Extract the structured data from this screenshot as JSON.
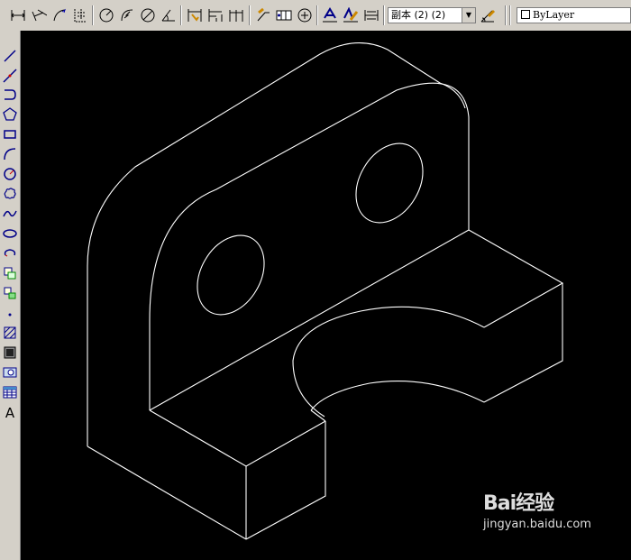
{
  "toolbar": {
    "buttons": [
      {
        "name": "linear-dim-icon"
      },
      {
        "name": "aligned-dim-icon"
      },
      {
        "name": "arc-length-icon"
      },
      {
        "name": "ordinate-dim-icon"
      },
      {
        "name": "radius-dim-icon"
      },
      {
        "name": "jogged-dim-icon"
      },
      {
        "name": "diameter-dim-icon"
      },
      {
        "name": "angular-dim-icon"
      },
      {
        "name": "quick-dim-icon"
      },
      {
        "name": "baseline-dim-icon"
      },
      {
        "name": "continue-dim-icon"
      },
      {
        "name": "quick-leader-icon"
      },
      {
        "name": "tolerance-icon"
      },
      {
        "name": "center-mark-icon"
      },
      {
        "name": "dim-edit-icon"
      },
      {
        "name": "dim-text-edit-icon"
      },
      {
        "name": "dim-update-icon"
      }
    ],
    "dim_style_value": "副本 (2) (2)",
    "layer_value": "ByLayer"
  },
  "left_toolbar": {
    "text_tool_label": "A"
  },
  "watermark": {
    "brand": "Bai经验",
    "url": "jingyan.baidu.com"
  }
}
